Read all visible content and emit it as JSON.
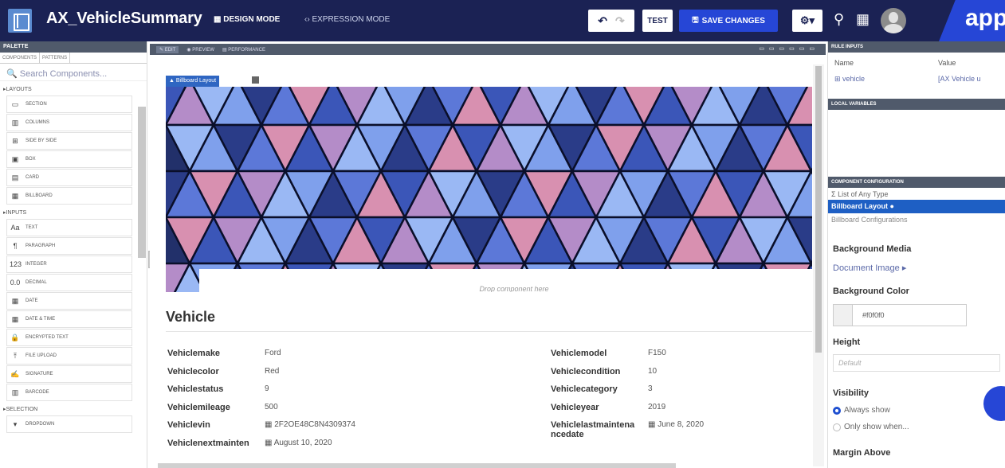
{
  "header": {
    "title": "AX_VehicleSummary",
    "design_mode": "DESIGN MODE",
    "expression_mode": "EXPRESSION MODE",
    "test": "TEST",
    "save": "SAVE CHANGES",
    "brand": "app"
  },
  "palette": {
    "title": "PALETTE",
    "tab_components": "COMPONENTS",
    "tab_patterns": "PATTERNS",
    "search_placeholder": "Search Components...",
    "layouts_label": "LAYOUTS",
    "layouts": [
      {
        "label": "SECTION",
        "icon": "section-icon"
      },
      {
        "label": "COLUMNS",
        "icon": "columns-icon"
      },
      {
        "label": "SIDE BY SIDE",
        "icon": "side-by-side-icon"
      },
      {
        "label": "BOX",
        "icon": "box-icon"
      },
      {
        "label": "CARD",
        "icon": "card-icon"
      },
      {
        "label": "BILLBOARD",
        "icon": "billboard-icon"
      }
    ],
    "inputs_label": "INPUTS",
    "inputs": [
      {
        "label": "TEXT",
        "icon": "text-icon"
      },
      {
        "label": "PARAGRAPH",
        "icon": "paragraph-icon"
      },
      {
        "label": "INTEGER",
        "icon": "integer-icon"
      },
      {
        "label": "DECIMAL",
        "icon": "decimal-icon"
      },
      {
        "label": "DATE",
        "icon": "date-icon"
      },
      {
        "label": "DATE & TIME",
        "icon": "datetime-icon"
      },
      {
        "label": "ENCRYPTED TEXT",
        "icon": "lock-icon"
      },
      {
        "label": "FILE UPLOAD",
        "icon": "upload-icon"
      },
      {
        "label": "SIGNATURE",
        "icon": "signature-icon"
      },
      {
        "label": "BARCODE",
        "icon": "barcode-icon"
      }
    ],
    "selection_label": "SELECTION",
    "selection": [
      {
        "label": "DROPDOWN",
        "icon": "dropdown-icon"
      }
    ]
  },
  "canvas_toolbar": {
    "edit": "EDIT",
    "preview": "PREVIEW",
    "performance": "PERFORMANCE"
  },
  "canvas": {
    "billboard_label": "Billboard Layout",
    "drop_text": "Drop component here",
    "section_title": "Vehicle",
    "left_fields": [
      {
        "label": "Vehiclemake",
        "value": "Ford"
      },
      {
        "label": "Vehiclecolor",
        "value": "Red"
      },
      {
        "label": "Vehiclestatus",
        "value": "9"
      },
      {
        "label": "Vehiclemileage",
        "value": "500"
      },
      {
        "label": "Vehiclevin",
        "value": "2F2OE48C8N4309374"
      },
      {
        "label": "Vehiclenextmainten",
        "value": "August 10, 2020"
      }
    ],
    "right_fields": [
      {
        "label": "Vehiclemodel",
        "value": "F150"
      },
      {
        "label": "Vehiclecondition",
        "value": "10"
      },
      {
        "label": "Vehiclecategory",
        "value": "3"
      },
      {
        "label": "Vehicleyear",
        "value": "2019"
      },
      {
        "label": "Vehiclelastmaintena",
        "label2": "ncedate",
        "value": "June 8, 2020"
      }
    ]
  },
  "right_panel": {
    "rule_inputs": "RULE INPUTS",
    "col_name": "Name",
    "col_value": "Value",
    "input_name": "vehicle",
    "input_value": "[AX Vehicle u",
    "local_vars": "LOCAL VARIABLES",
    "component_config": "COMPONENT CONFIGURATION",
    "cfg_list": "List of Any Type",
    "cfg_billboard": "Billboard Layout",
    "cfg_billboard_conf": "Billboard Configurations",
    "bg_media_label": "Background Media",
    "bg_media_value": "Document Image",
    "bg_color_label": "Background Color",
    "bg_color_value": "#f0f0f0",
    "height_label": "Height",
    "height_value": "Default",
    "visibility_label": "Visibility",
    "always_show": "Always show",
    "only_show": "Only show when...",
    "margin_label": "Margin Above"
  }
}
